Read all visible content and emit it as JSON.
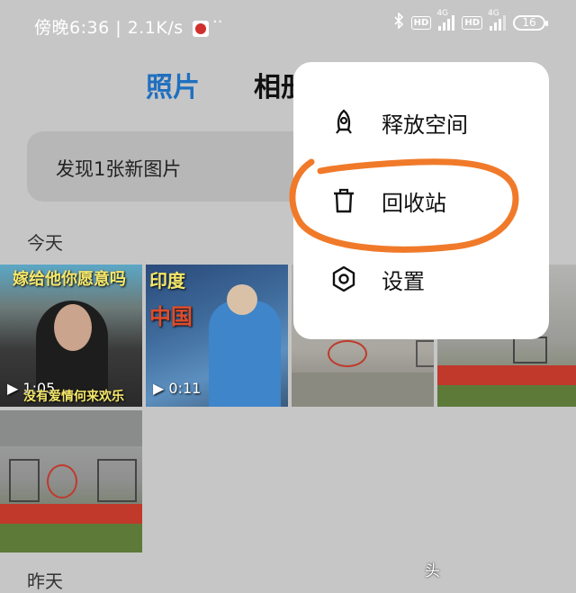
{
  "status_bar": {
    "time_and_speed": "傍晚6:36 | 2.1K/s",
    "more": "··",
    "hd1": "HD",
    "net1": "4G",
    "hd2": "HD",
    "net2": "4G",
    "battery": "16",
    "icons": [
      "app-icon",
      "bluetooth-icon",
      "signal-icon",
      "signal-icon",
      "battery-icon"
    ]
  },
  "tabs": [
    {
      "label": "照片",
      "active": true
    },
    {
      "label": "相册",
      "active": false
    }
  ],
  "banner": {
    "text": "发现1张新图片"
  },
  "sections": {
    "today": "今天",
    "yesterday": "昨天"
  },
  "photos": [
    {
      "caption_top": "嫁给他你愿意吗",
      "caption_bottom": "没有爱情何来欢乐",
      "duration": "1:05",
      "type": "video"
    },
    {
      "caption_top": "印度",
      "caption_mid": "中国",
      "duration": "0:11",
      "type": "video"
    },
    {
      "type": "image"
    },
    {
      "type": "image"
    },
    {
      "type": "image"
    }
  ],
  "menu": {
    "items": [
      {
        "label": "释放空间",
        "icon": "rocket-icon"
      },
      {
        "label": "回收站",
        "icon": "trash-icon"
      },
      {
        "label": "设置",
        "icon": "gear-icon"
      }
    ]
  },
  "colors": {
    "accent": "#1f6fbf",
    "annotation": "#f07a2a",
    "menu_bg": "#ffffff",
    "overlay": "#c6c6c6"
  },
  "watermark": "头"
}
